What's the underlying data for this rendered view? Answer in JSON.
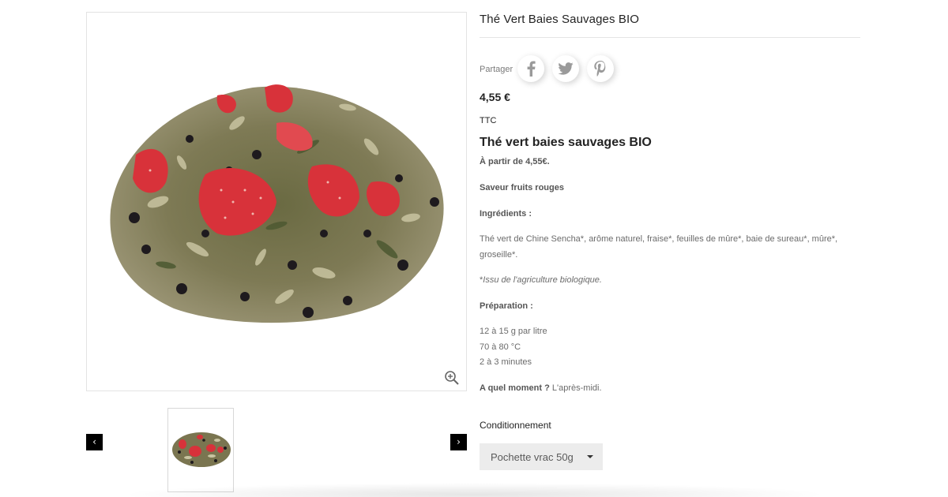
{
  "product": {
    "title": "Thé Vert Baies Sauvages BIO",
    "share_label": "Partager",
    "share_icons": [
      "facebook-icon",
      "twitter-icon",
      "pinterest-icon"
    ],
    "price": "4,55 €",
    "tax_label": "TTC",
    "heading": "Thé vert baies sauvages BIO",
    "starting_price": "À partir de 4,55€.",
    "flavor": "Saveur fruits rouges",
    "ingredients_label": "Ingrédients :",
    "ingredients_line1": "Thé vert de Chine Sencha*, arôme naturel, fraise*, feuilles de mûre*, baie de sureau*, mûre*,",
    "ingredients_line2": "groseille*.",
    "organic_note": "Issu de l'agriculture biologique.",
    "organic_star": "*",
    "preparation_label": "Préparation :",
    "preparation_lines": [
      "12 à 15 g par litre",
      "70 à 80 °C",
      "2 à 3 minutes"
    ],
    "moment_label": "A quel moment ?",
    "moment_value": "L'après-midi.",
    "packaging_label": "Conditionnement",
    "packaging_selected": "Pochette vrac 50g"
  },
  "gallery": {
    "prev": "‹",
    "next": "›"
  },
  "colors": {
    "accent_black": "#000000",
    "select_bg": "#ececec",
    "strawberry": "#d8323a"
  }
}
